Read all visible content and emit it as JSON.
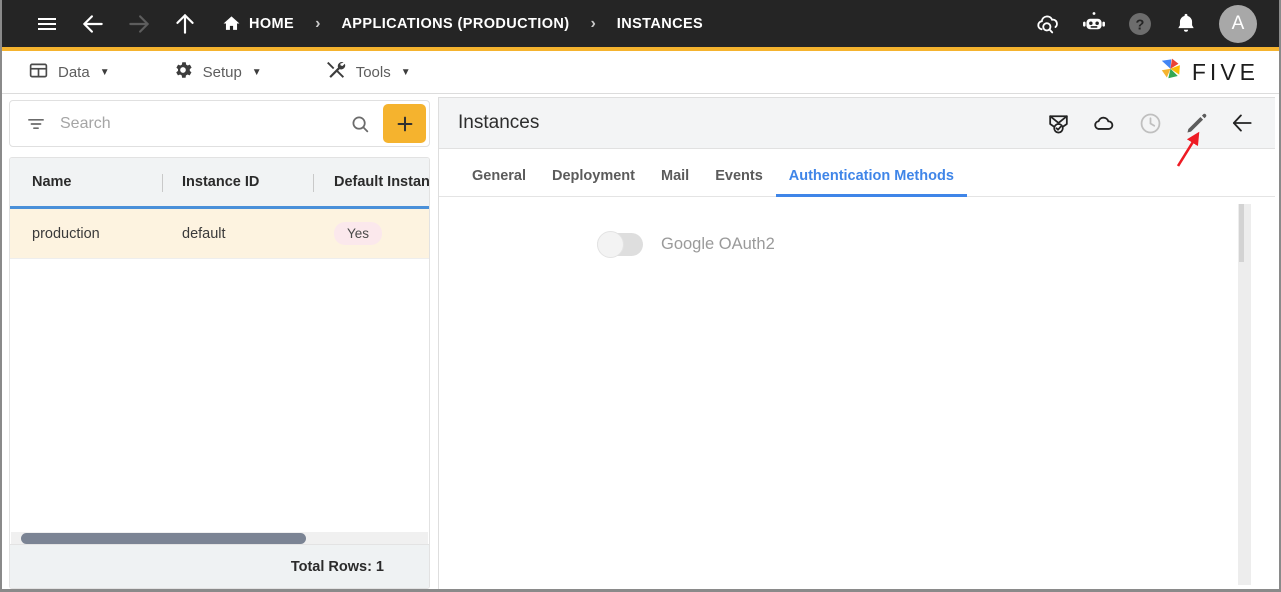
{
  "topbar": {
    "nav": [
      {
        "name": "menu-icon",
        "label": "Menu"
      },
      {
        "name": "back-icon",
        "label": "Back"
      },
      {
        "name": "forward-icon",
        "label": "Forward"
      },
      {
        "name": "up-icon",
        "label": "Up"
      }
    ],
    "breadcrumbs": [
      {
        "label": "HOME",
        "icon": "home-icon"
      },
      {
        "label": "APPLICATIONS (PRODUCTION)",
        "icon": ""
      },
      {
        "label": "INSTANCES",
        "icon": ""
      }
    ],
    "separator": "›",
    "right_icons": [
      {
        "name": "cloud-search-icon",
        "label": "Cloud Search"
      },
      {
        "name": "robot-icon",
        "label": "Assistant"
      },
      {
        "name": "help-icon",
        "label": "Help"
      },
      {
        "name": "bell-icon",
        "label": "Notifications"
      }
    ],
    "avatar_initial": "A"
  },
  "menubar": {
    "items": [
      {
        "label": "Data",
        "icon": "table-icon",
        "caret": "▼"
      },
      {
        "label": "Setup",
        "icon": "gear-icon",
        "caret": "▼"
      },
      {
        "label": "Tools",
        "icon": "tools-icon",
        "caret": "▼"
      }
    ],
    "brand": {
      "word": "FIVE",
      "mark": "pinwheel-logo"
    }
  },
  "left_panel": {
    "search": {
      "placeholder": "Search",
      "value": ""
    },
    "filter_icon": "filter-icon",
    "search_icon": "search-icon",
    "add_button_label": "+",
    "grid": {
      "columns": [
        "Name",
        "Instance ID",
        "Default Instance"
      ],
      "rows": [
        {
          "name": "production",
          "instance_id": "default",
          "default_instance": "Yes"
        }
      ]
    },
    "footer": {
      "total_rows_label": "Total Rows: 1"
    }
  },
  "right_panel": {
    "title": "Instances",
    "actions": [
      {
        "name": "envelope-check-icon",
        "label": "Verify Email",
        "disabled": false
      },
      {
        "name": "cloud-icon",
        "label": "Cloud",
        "disabled": false
      },
      {
        "name": "clock-icon",
        "label": "History",
        "disabled": true
      },
      {
        "name": "pencil-icon",
        "label": "Edit",
        "disabled": false
      },
      {
        "name": "arrow-left-icon",
        "label": "Back",
        "disabled": false
      }
    ],
    "tabs": [
      {
        "label": "General",
        "active": false
      },
      {
        "label": "Deployment",
        "active": false
      },
      {
        "label": "Mail",
        "active": false
      },
      {
        "label": "Events",
        "active": false
      },
      {
        "label": "Authentication Methods",
        "active": true
      }
    ],
    "body": {
      "auth_methods": [
        {
          "label": "Google OAuth2",
          "enabled": false
        }
      ]
    }
  },
  "colors": {
    "accent_amber": "#f5b32e",
    "accent_blue": "#3f85e8",
    "header_dark": "#252525",
    "row_highlight": "#fdf3e0",
    "badge_bg": "#fbe8ec",
    "annotation_red": "#ee1b24"
  }
}
